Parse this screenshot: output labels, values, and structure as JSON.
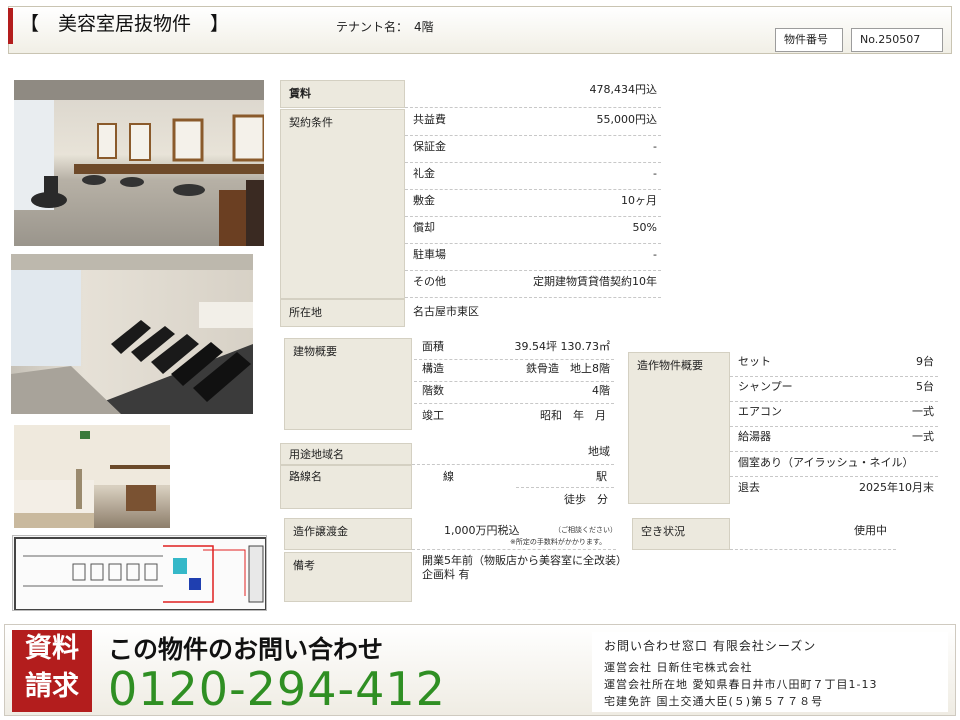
{
  "header": {
    "title": "【　美容室居抜物件　】",
    "tenant_label": "テナント名：",
    "tenant_value": "4階",
    "property_no_label": "物件番号",
    "property_no_value": "No.250507"
  },
  "images": {
    "photo1": "salon-interior-photo",
    "photo2": "shampoo-area-photo",
    "photo3": "treatment-room-photo",
    "floorplan": "floor-plan-image"
  },
  "rent": {
    "label": "賃料",
    "value": "478,434円込"
  },
  "contract": {
    "label": "契約条件",
    "rows": [
      {
        "key": "共益費",
        "value": "55,000円込"
      },
      {
        "key": "保証金",
        "value": "-"
      },
      {
        "key": "礼金",
        "value": "-"
      },
      {
        "key": "敷金",
        "value": "10ヶ月"
      },
      {
        "key": "償却",
        "value": "50%"
      },
      {
        "key": "駐車場",
        "value": "-"
      },
      {
        "key": "その他",
        "value": "定期建物賃貸借契約10年"
      }
    ]
  },
  "location": {
    "label": "所在地",
    "value": "名古屋市東区"
  },
  "building": {
    "label": "建物概要",
    "rows": [
      {
        "key": "面積",
        "value": "39.54坪 130.73㎡"
      },
      {
        "key": "構造",
        "value": "鉄骨造　地上8階"
      },
      {
        "key": "階数",
        "value": "4階"
      },
      {
        "key": "竣工",
        "value": "昭和　年　月"
      }
    ]
  },
  "zoning": {
    "label": "用途地域名",
    "value": "地域"
  },
  "route": {
    "label": "路線名",
    "line": "線",
    "station": "駅",
    "walk": "徒歩　分"
  },
  "fixtures": {
    "label": "造作物件概要",
    "rows": [
      {
        "key": "セット",
        "value": "9台"
      },
      {
        "key": "シャンプー",
        "value": "5台"
      },
      {
        "key": "エアコン",
        "value": "一式"
      },
      {
        "key": "給湯器",
        "value": "一式"
      },
      {
        "key": "個室あり（アイラッシュ・ネイル）",
        "value": ""
      },
      {
        "key": "退去",
        "value": "2025年10月末"
      }
    ]
  },
  "transfer": {
    "label": "造作譲渡金",
    "value": "1,000万円税込",
    "note1": "（ご相談ください）",
    "note2": "※所定の手数料がかかります。"
  },
  "vacancy": {
    "label": "空き状況",
    "value": "使用中"
  },
  "remarks": {
    "label": "備考",
    "line1": "開業5年前（物販店から美容室に全改装）",
    "line2": "企画料 有"
  },
  "footer": {
    "request_line1": "資料",
    "request_line2": "請求",
    "inquiry_title": "この物件のお問い合わせ",
    "phone": "0120-294-412",
    "company_lines": [
      "お問い合わせ窓口 有限会社シーズン",
      "運営会社 日新住宅株式会社",
      "運営会社所在地 愛知県春日井市八田町７丁目1-13",
      "宅建免許 国土交通大臣(５)第５７７８号"
    ]
  },
  "colors": {
    "accent_red": "#b31d1d",
    "phone_green": "#2f8f23",
    "label_bg": "#ece9de"
  }
}
